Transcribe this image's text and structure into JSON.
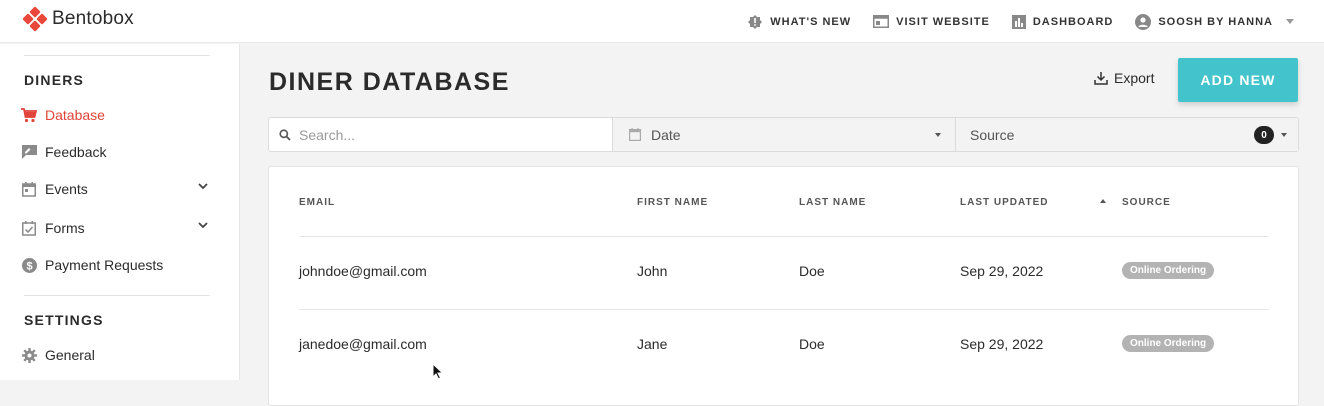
{
  "brand": {
    "name": "Bentobox"
  },
  "topnav": {
    "whats_new": "WHAT'S NEW",
    "visit_website": "VISIT WEBSITE",
    "dashboard": "DASHBOARD",
    "account": "SOOSH BY HANNA"
  },
  "sidebar": {
    "diners_title": "DINERS",
    "settings_title": "SETTINGS",
    "items": [
      {
        "label": "Database",
        "icon": "cart-icon"
      },
      {
        "label": "Feedback",
        "icon": "feedback-icon"
      },
      {
        "label": "Events",
        "icon": "calendar-icon"
      },
      {
        "label": "Forms",
        "icon": "forms-icon"
      },
      {
        "label": "Payment Requests",
        "icon": "dollar-icon"
      }
    ],
    "settings_items": [
      {
        "label": "General",
        "icon": "gear-icon"
      }
    ]
  },
  "main": {
    "title": "DINER DATABASE",
    "export_label": "Export",
    "add_new_label": "ADD NEW"
  },
  "filters": {
    "search_placeholder": "Search...",
    "date_label": "Date",
    "source_label": "Source",
    "source_count": "0"
  },
  "table": {
    "columns": [
      "EMAIL",
      "FIRST NAME",
      "LAST NAME",
      "LAST UPDATED",
      "SOURCE"
    ],
    "rows": [
      {
        "email": "johndoe@gmail.com",
        "first": "John",
        "last": "Doe",
        "updated": "Sep 29, 2022",
        "source": "Online Ordering"
      },
      {
        "email": "janedoe@gmail.com",
        "first": "Jane",
        "last": "Doe",
        "updated": "Sep 29, 2022",
        "source": "Online Ordering"
      }
    ]
  },
  "colors": {
    "accent_red": "#e0443a",
    "add_new_teal": "#43c4cc",
    "pill_gray": "#b3b3b3"
  }
}
